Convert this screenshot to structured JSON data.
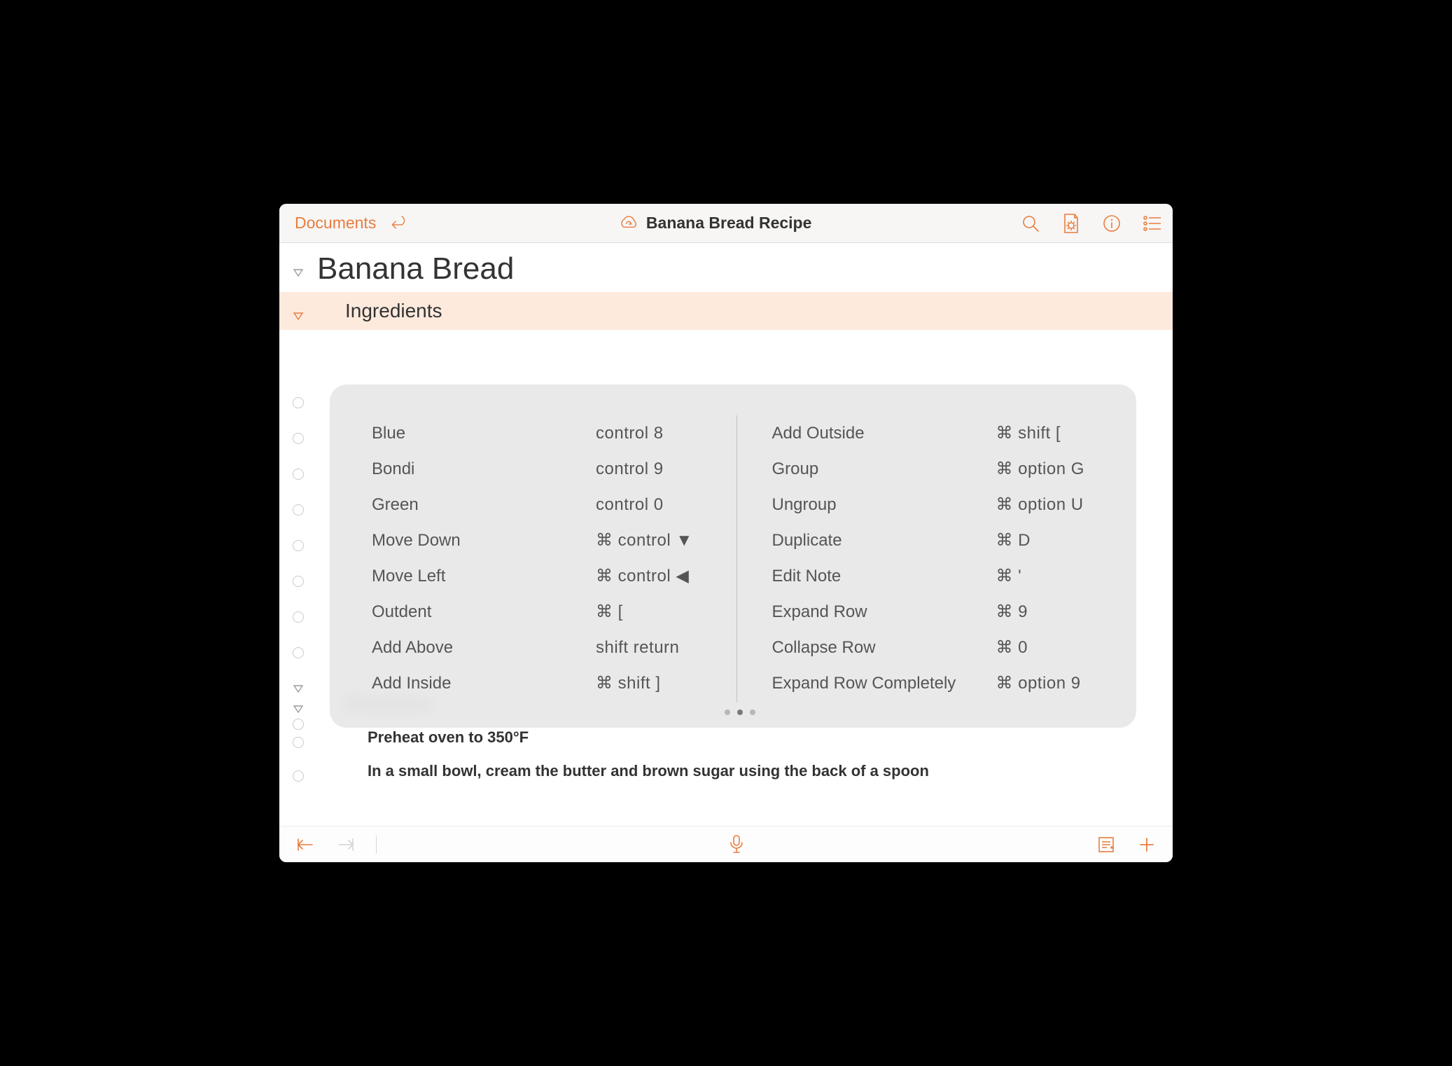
{
  "toolbar": {
    "back_label": "Documents",
    "title": "Banana Bread Recipe"
  },
  "outline": {
    "title": "Banana Bread",
    "section_ingredients": "Ingredients",
    "section_directions": "Directions",
    "directions": [
      "Preheat oven to 350°F",
      "In a small bowl, cream the butter and brown sugar using the back of a spoon"
    ]
  },
  "shortcuts": {
    "left": [
      {
        "label": "Blue",
        "key": "control 8"
      },
      {
        "label": "Bondi",
        "key": "control 9"
      },
      {
        "label": "Green",
        "key": "control 0"
      },
      {
        "label": "Move Down",
        "key": "⌘  control ▼"
      },
      {
        "label": "Move Left",
        "key": "⌘  control ◀"
      },
      {
        "label": "Outdent",
        "key": "⌘  ["
      },
      {
        "label": "Add Above",
        "key": "shift return"
      },
      {
        "label": "Add Inside",
        "key": "⌘  shift ]"
      }
    ],
    "right": [
      {
        "label": "Add Outside",
        "key": "⌘  shift ["
      },
      {
        "label": "Group",
        "key": "⌘  option G"
      },
      {
        "label": "Ungroup",
        "key": "⌘  option U"
      },
      {
        "label": "Duplicate",
        "key": "⌘  D"
      },
      {
        "label": "Edit Note",
        "key": "⌘  '"
      },
      {
        "label": "Expand Row",
        "key": "⌘  9"
      },
      {
        "label": "Collapse Row",
        "key": "⌘  0"
      },
      {
        "label": "Expand Row Completely",
        "key": "⌘  option 9"
      }
    ],
    "page_index": 1,
    "page_count": 3
  }
}
